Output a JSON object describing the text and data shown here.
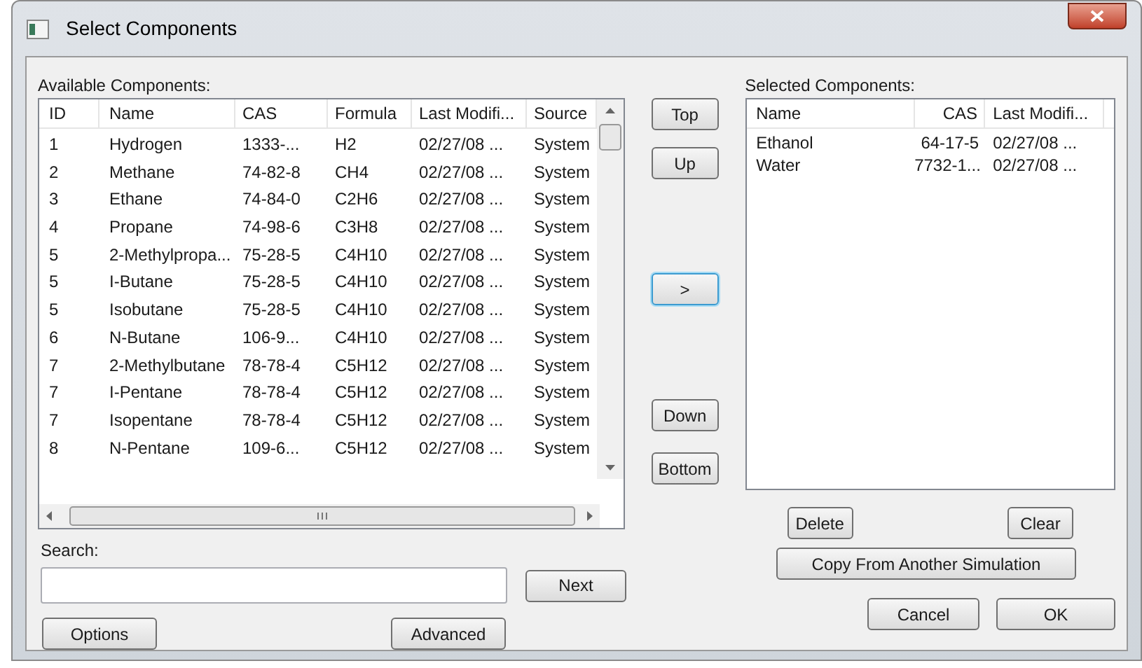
{
  "window": {
    "title": "Select Components"
  },
  "available": {
    "label": "Available Components:",
    "columns": [
      "ID",
      "Name",
      "CAS",
      "Formula",
      "Last Modifi...",
      "Source"
    ],
    "rows": [
      [
        "1",
        "Hydrogen",
        "1333-...",
        "H2",
        "02/27/08 ...",
        "System"
      ],
      [
        "2",
        "Methane",
        "74-82-8",
        "CH4",
        "02/27/08 ...",
        "System"
      ],
      [
        "3",
        "Ethane",
        "74-84-0",
        "C2H6",
        "02/27/08 ...",
        "System"
      ],
      [
        "4",
        "Propane",
        "74-98-6",
        "C3H8",
        "02/27/08 ...",
        "System"
      ],
      [
        "5",
        "2-Methylpropa...",
        "75-28-5",
        "C4H10",
        "02/27/08 ...",
        "System"
      ],
      [
        "5",
        "I-Butane",
        "75-28-5",
        "C4H10",
        "02/27/08 ...",
        "System"
      ],
      [
        "5",
        "Isobutane",
        "75-28-5",
        "C4H10",
        "02/27/08 ...",
        "System"
      ],
      [
        "6",
        "N-Butane",
        "106-9...",
        "C4H10",
        "02/27/08 ...",
        "System"
      ],
      [
        "7",
        "2-Methylbutane",
        "78-78-4",
        "C5H12",
        "02/27/08 ...",
        "System"
      ],
      [
        "7",
        "I-Pentane",
        "78-78-4",
        "C5H12",
        "02/27/08 ...",
        "System"
      ],
      [
        "7",
        "Isopentane",
        "78-78-4",
        "C5H12",
        "02/27/08 ...",
        "System"
      ],
      [
        "8",
        "N-Pentane",
        "109-6...",
        "C5H12",
        "02/27/08 ...",
        "System"
      ]
    ]
  },
  "move_buttons": {
    "top": "Top",
    "up": "Up",
    "add": ">",
    "down": "Down",
    "bottom": "Bottom"
  },
  "selected": {
    "label": "Selected Components:",
    "columns": [
      "Name",
      "CAS",
      "Last Modifi..."
    ],
    "rows": [
      [
        "Ethanol",
        "64-17-5",
        "02/27/08 ..."
      ],
      [
        "Water",
        "7732-1...",
        "02/27/08 ..."
      ]
    ]
  },
  "search": {
    "label": "Search:",
    "next": "Next"
  },
  "buttons": {
    "delete": "Delete",
    "clear": "Clear",
    "copy": "Copy From Another Simulation",
    "options": "Options",
    "advanced": "Advanced",
    "cancel": "Cancel",
    "ok": "OK"
  }
}
